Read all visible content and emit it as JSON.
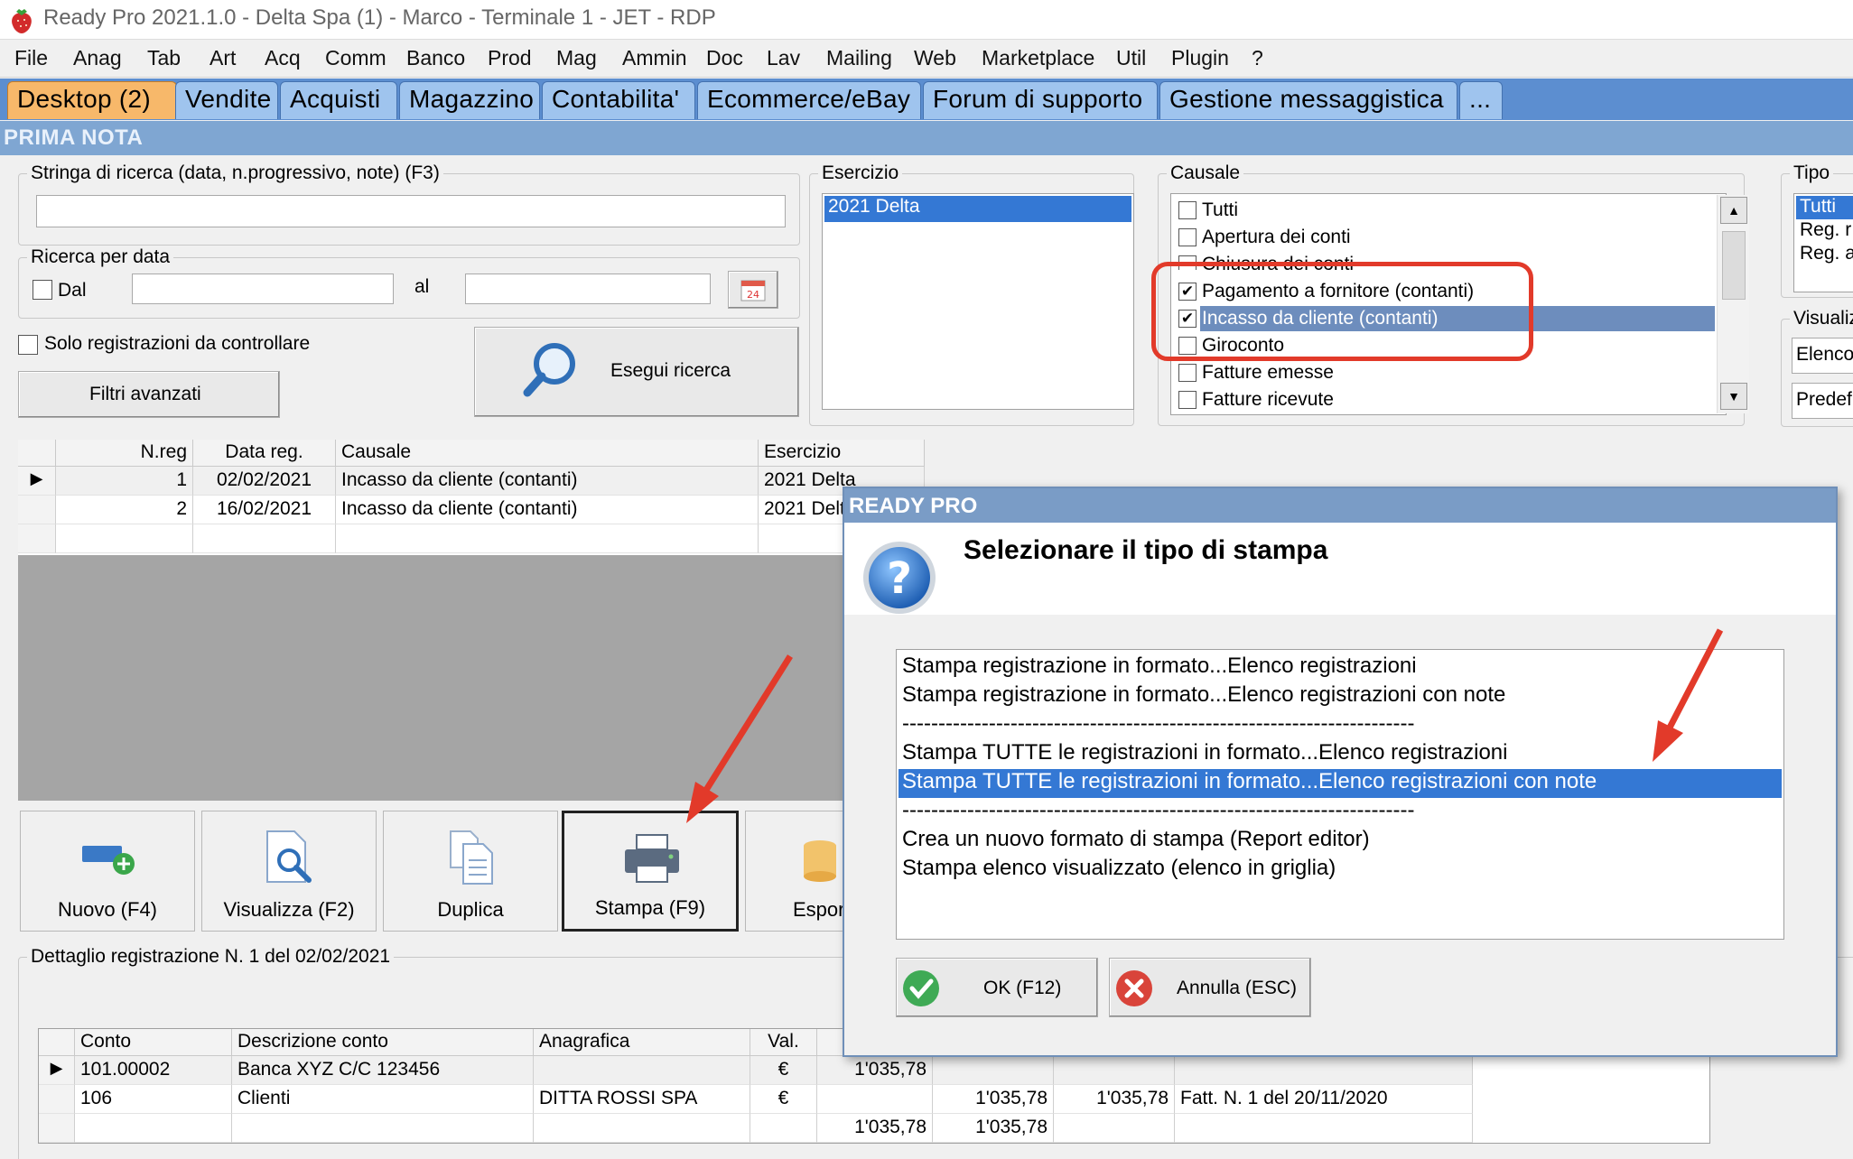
{
  "window": {
    "title": "Ready Pro 2021.1.0 - Delta Spa (1) - Marco - Terminale 1 - JET - RDP"
  },
  "menu": [
    "File",
    "Anag",
    "Tab",
    "Art",
    "Acq",
    "Comm",
    "Banco",
    "Prod",
    "Mag",
    "Ammin",
    "Doc",
    "Lav",
    "Mailing",
    "Web",
    "Marketplace",
    "Util",
    "Plugin",
    "?"
  ],
  "tabs": [
    "Desktop (2)",
    "Vendite",
    "Acquisti",
    "Magazzino",
    "Contabilita'",
    "Ecommerce/eBay",
    "Forum di supporto",
    "Gestione messaggistica",
    "..."
  ],
  "section": {
    "title": "PRIMA NOTA"
  },
  "search": {
    "legend": "Stringa di ricerca (data, n.progressivo, note) (F3)",
    "value": "",
    "date_legend": "Ricerca per data",
    "dal_label": "Dal",
    "al_label": "al",
    "date_from": "",
    "date_to": "",
    "calendar_badge": "24",
    "solo_label": "Solo registrazioni da controllare",
    "advanced_label": "Filtri avanzati",
    "run_label": "Esegui ricerca"
  },
  "esercizio": {
    "legend": "Esercizio",
    "items": [
      "2021 Delta"
    ]
  },
  "causale": {
    "legend": "Causale",
    "items": [
      {
        "label": "Tutti",
        "checked": false
      },
      {
        "label": "Apertura dei conti",
        "checked": false
      },
      {
        "label": "Chiusura dei conti",
        "checked": false
      },
      {
        "label": "Pagamento a fornitore (contanti)",
        "checked": true
      },
      {
        "label": "Incasso da cliente (contanti)",
        "checked": true
      },
      {
        "label": "Giroconto",
        "checked": false
      },
      {
        "label": "Fatture emesse",
        "checked": false
      },
      {
        "label": "Fatture ricevute",
        "checked": false
      }
    ]
  },
  "tipo": {
    "legend": "Tipo",
    "items": [
      "Tutti",
      "Reg. r",
      "Reg. a"
    ]
  },
  "visualizza": {
    "legend": "Visualiz",
    "fields": [
      "Elenco",
      "Predef"
    ]
  },
  "registrazioni": {
    "columns": [
      "N.reg",
      "Data reg.",
      "Causale",
      "Esercizio"
    ],
    "rows": [
      {
        "nreg": "1",
        "data": "02/02/2021",
        "causale": "Incasso da cliente (contanti)",
        "esercizio": "2021 Delta"
      },
      {
        "nreg": "2",
        "data": "16/02/2021",
        "causale": "Incasso da cliente (contanti)",
        "esercizio": "2021 Delta"
      }
    ]
  },
  "toolbar": {
    "nuovo": "Nuovo (F4)",
    "visualizza": "Visualizza (F2)",
    "duplica": "Duplica",
    "stampa": "Stampa (F9)",
    "esporta": "Espor"
  },
  "dettaglio": {
    "legend": "Dettaglio registrazione N. 1 del 02/02/2021",
    "columns": [
      "Conto",
      "Descrizione conto",
      "Anagrafica",
      "Val."
    ],
    "rows": [
      {
        "conto": "101.00002",
        "descrizione": "Banca XYZ C/C 123456",
        "anagrafica": "",
        "val": "€",
        "dare": "1'035,78",
        "avere": "",
        "importo": "",
        "note": ""
      },
      {
        "conto": "106",
        "descrizione": "Clienti",
        "anagrafica": "DITTA ROSSI SPA",
        "val": "€",
        "dare": "",
        "avere": "1'035,78",
        "importo": "1'035,78",
        "note": "Fatt. N. 1 del 20/11/2020"
      },
      {
        "conto": "",
        "descrizione": "",
        "anagrafica": "",
        "val": "",
        "dare": "1'035,78",
        "avere": "1'035,78",
        "importo": "",
        "note": ""
      }
    ]
  },
  "dialog": {
    "title": "READY PRO",
    "heading": "Selezionare il tipo di stampa",
    "options": [
      "Stampa registrazione in formato...Elenco registrazioni",
      "Stampa registrazione in formato...Elenco registrazioni con note",
      "-----------------------------------------------------------------------",
      "Stampa TUTTE le registrazioni in formato...Elenco registrazioni",
      "Stampa TUTTE le registrazioni in formato...Elenco registrazioni con note",
      "-----------------------------------------------------------------------",
      "Crea un nuovo formato di stampa (Report editor)",
      "Stampa elenco visualizzato (elenco in griglia)"
    ],
    "selected_index": 4,
    "ok_label": "OK (F12)",
    "cancel_label": "Annulla (ESC)"
  },
  "colors": {
    "tab_active": "#f7b86a",
    "tab": "#9fc4ee",
    "selection": "#3478d4",
    "annotation": "#e23a2a"
  }
}
